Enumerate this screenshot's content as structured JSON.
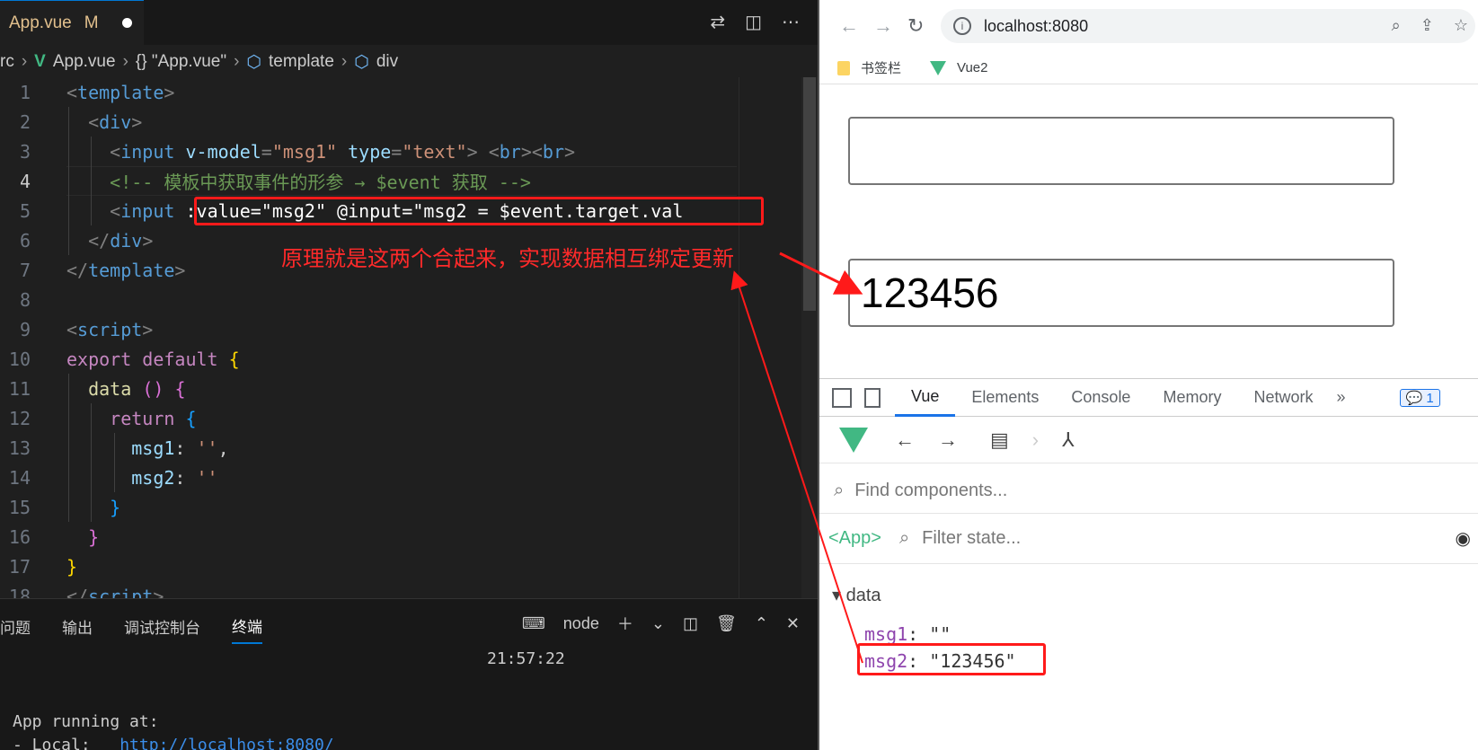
{
  "editor": {
    "tab": {
      "filename": "App.vue",
      "modified": "M"
    },
    "breadcrumb": [
      "rc",
      "App.vue",
      "{} \"App.vue\"",
      "template",
      "div"
    ],
    "line_numbers": [
      "1",
      "2",
      "3",
      "4",
      "5",
      "6",
      "7",
      "8",
      "9",
      "10",
      "11",
      "12",
      "13",
      "14",
      "15",
      "16",
      "17",
      "18"
    ],
    "annotation": "原理就是这两个合起来，实现数据相互绑定更新",
    "code": {
      "l3_attr": "v-model",
      "l3_val": "\"msg1\"",
      "l3_type": "type",
      "l3_type_val": "\"text\"",
      "l4_comment": "<!-- 模板中获取事件的形参 → $event 获取 -->",
      "l5_rest": ":value=\"msg2\" @input=\"msg2 = $event.target.val",
      "l10_export": "export",
      "l10_default": "default",
      "l11_data": "data",
      "l12_return": "return",
      "l13": "msg1",
      "l14": "msg2",
      "empty_str": "''"
    }
  },
  "panel": {
    "tabs": [
      "问题",
      "输出",
      "调试控制台",
      "终端"
    ],
    "active_tab": "终端",
    "shell": "node",
    "time": "21:57:22",
    "line1": "App running at:",
    "line2_prefix": "- Local:   ",
    "line2_link": "http://localhost:8080/"
  },
  "browser": {
    "url": "localhost:8080",
    "bookmarks": [
      "书签栏",
      "Vue2"
    ],
    "input1_value": "",
    "input2_value": "123456"
  },
  "devtools": {
    "tabs": [
      "Vue",
      "Elements",
      "Console",
      "Memory",
      "Network"
    ],
    "active_tab": "Vue",
    "more": "»",
    "badge": "1",
    "find_placeholder": "Find components...",
    "component": "<App>",
    "filter_placeholder": "Filter state...",
    "section": "data",
    "props": [
      {
        "key": "msg1",
        "value": "\"\""
      },
      {
        "key": "msg2",
        "value": "\"123456\""
      }
    ]
  }
}
